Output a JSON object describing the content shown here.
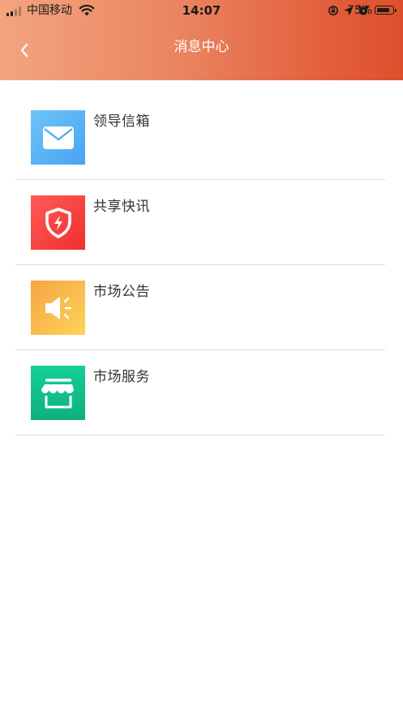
{
  "status_bar": {
    "carrier": "中国移动",
    "time": "14:07",
    "battery_percent": "75%",
    "battery_level": 0.75
  },
  "nav": {
    "title": "消息中心",
    "back_icon": "chevron-left-icon"
  },
  "colors": {
    "header_gradient_start": "#f2a57f",
    "header_gradient_end": "#dd4f2c",
    "mailbox_icon": "#4aa8f5",
    "news_icon": "#f0403a",
    "announcement_icon": "#f9c24a",
    "service_icon": "#12c28e"
  },
  "menu": {
    "items": [
      {
        "label": "领导信箱",
        "icon": "mail-icon"
      },
      {
        "label": "共享快讯",
        "icon": "shield-bolt-icon"
      },
      {
        "label": "市场公告",
        "icon": "megaphone-icon"
      },
      {
        "label": "市场服务",
        "icon": "storefront-icon"
      }
    ]
  }
}
